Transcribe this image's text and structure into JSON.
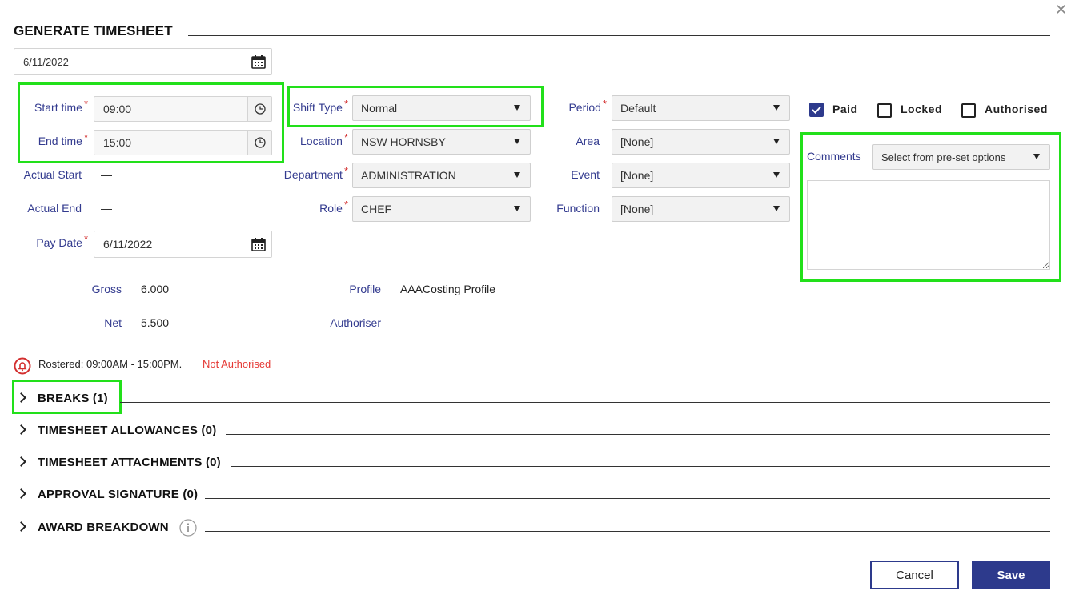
{
  "title": "GENERATE TIMESHEET",
  "date_value": "6/11/2022",
  "start_time": {
    "label": "Start time",
    "value": "09:00"
  },
  "end_time": {
    "label": "End time",
    "value": "15:00"
  },
  "actual_start": {
    "label": "Actual Start",
    "value": "—"
  },
  "actual_end": {
    "label": "Actual End",
    "value": "—"
  },
  "pay_date": {
    "label": "Pay Date",
    "value": "6/11/2022"
  },
  "shift_type": {
    "label": "Shift Type",
    "value": "Normal"
  },
  "location": {
    "label": "Location",
    "value": "NSW HORNSBY"
  },
  "department": {
    "label": "Department",
    "value": "ADMINISTRATION"
  },
  "role": {
    "label": "Role",
    "value": "CHEF"
  },
  "period": {
    "label": "Period",
    "value": "Default"
  },
  "area": {
    "label": "Area",
    "value": "[None]"
  },
  "event": {
    "label": "Event",
    "value": "[None]"
  },
  "function": {
    "label": "Function",
    "value": "[None]"
  },
  "flags": {
    "paid": "Paid",
    "locked": "Locked",
    "authorised": "Authorised",
    "paid_checked": true,
    "locked_checked": false,
    "authorised_checked": false
  },
  "comments": {
    "label": "Comments",
    "select_value": "Select from pre-set options"
  },
  "summary": {
    "gross_label": "Gross",
    "gross_value": "6.000",
    "net_label": "Net",
    "net_value": "5.500",
    "profile_label": "Profile",
    "profile_value": "AAACosting Profile",
    "authoriser_label": "Authoriser",
    "authoriser_value": "—"
  },
  "status": {
    "rostered": "Rostered: 09:00AM - 15:00PM.",
    "authorised": "Not Authorised"
  },
  "sections": {
    "breaks": "BREAKS (1)",
    "allowances": "TIMESHEET ALLOWANCES (0)",
    "attachments": "TIMESHEET ATTACHMENTS (0)",
    "signature": "APPROVAL SIGNATURE (0)",
    "award": "AWARD BREAKDOWN"
  },
  "buttons": {
    "cancel": "Cancel",
    "save": "Save"
  },
  "colors": {
    "accent": "#2d3a8c",
    "label": "#333b8f",
    "highlight": "#22e01a",
    "error": "#d32f2f"
  }
}
